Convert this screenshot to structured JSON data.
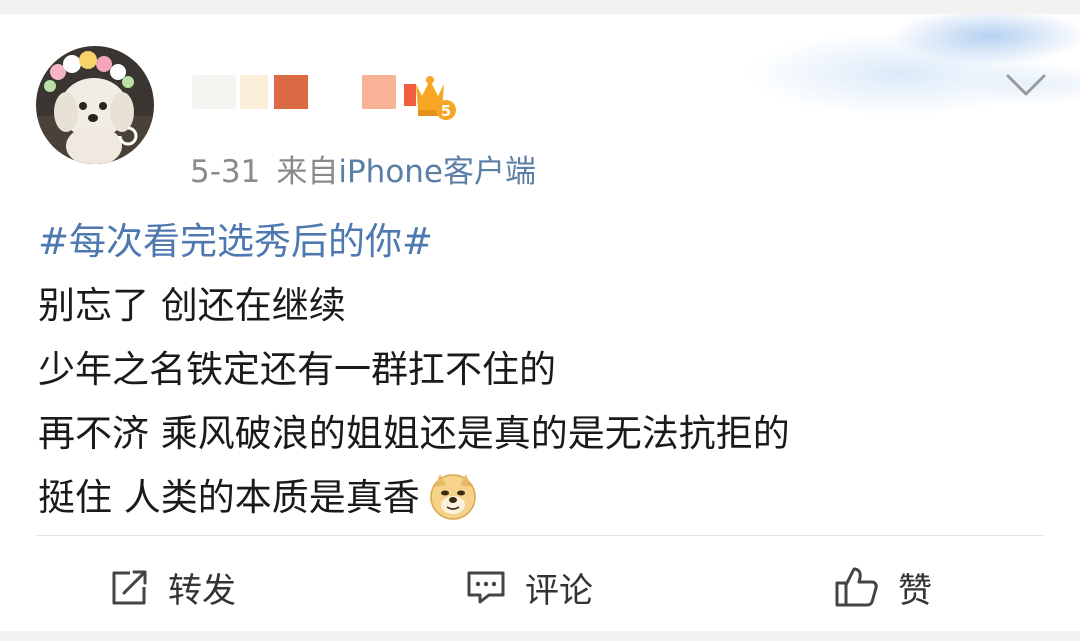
{
  "post": {
    "date": "5-31",
    "source_prefix": "来自",
    "source_app": "iPhone客户端",
    "hashtag": "#每次看完选秀后的你#",
    "lines": [
      "别忘了 创还在继续",
      "少年之名铁定还有一群扛不住的",
      "再不济 乘风破浪的姐姐还是真的是无法抗拒的",
      "挺住 人类的本质是真香"
    ]
  },
  "user": {
    "vip_level": "5",
    "name_blocks": [
      "#f2f2ef",
      "#fdf0dc",
      "#da6b45",
      "#f8b295",
      "#f25d3d"
    ]
  },
  "actions": {
    "repost": "转发",
    "comment": "评论",
    "like": "赞"
  },
  "icons": {
    "repost": "share-square-icon",
    "comment": "comment-bubble-icon",
    "like": "thumbs-up-icon",
    "menu": "chevron-down-icon",
    "emoji": "doge-emoji-icon",
    "vip": "vip-crown-icon"
  },
  "colors": {
    "hashtag": "#4d78b0",
    "source_link": "#5b7ea6",
    "meta": "#8a8a8a",
    "text": "#1a1a1a"
  }
}
